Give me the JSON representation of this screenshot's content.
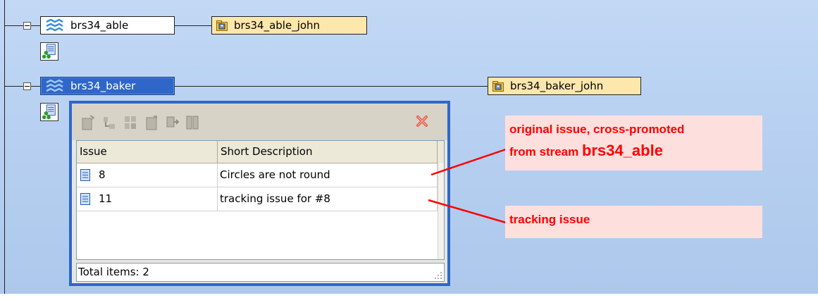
{
  "tree": {
    "streams": [
      {
        "name": "brs34_able",
        "selected": false
      },
      {
        "name": "brs34_baker",
        "selected": true
      }
    ],
    "workspaces": [
      {
        "name": "brs34_able_john"
      },
      {
        "name": "brs34_baker_john"
      }
    ]
  },
  "issues_panel": {
    "toolbar_icons": [
      "new-issue-icon",
      "move-issue-icon",
      "promote-issue-icon",
      "remove-issue-icon",
      "copy-issue-icon",
      "compare-issue-icon"
    ],
    "close_icon": "close-icon",
    "columns": [
      "Issue",
      "Short Description"
    ],
    "rows": [
      {
        "issue": "8",
        "description": "Circles are not round"
      },
      {
        "issue": "11",
        "description": "tracking issue for #8"
      }
    ],
    "status": "Total items: 2"
  },
  "annotations": {
    "original": {
      "line1": "original issue, cross-promoted",
      "line2_prefix": "from stream ",
      "line2_stream": "brs34_able"
    },
    "tracking": {
      "text": "tracking issue"
    }
  },
  "colors": {
    "background": "#b7d0f1",
    "selection": "#2f67c8",
    "workspace": "#fde7ad",
    "annotation_text": "#ff0000",
    "annotation_bg": "#fde0de"
  }
}
